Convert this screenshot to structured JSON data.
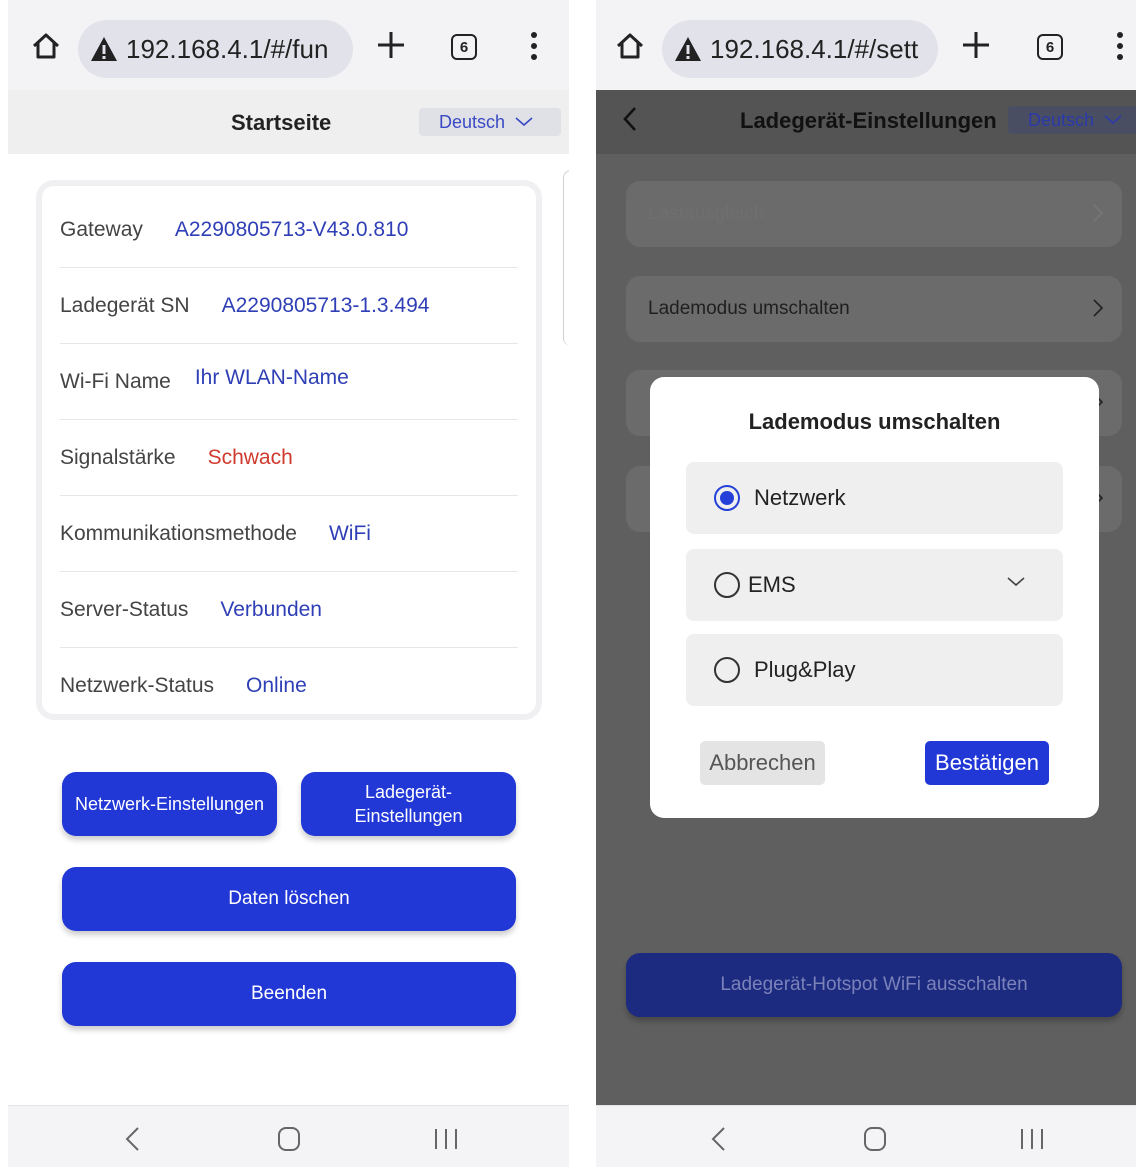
{
  "left": {
    "browser": {
      "url": "192.168.4.1/#/fun",
      "tab_count": "6"
    },
    "header": {
      "title": "Startseite",
      "language": "Deutsch"
    },
    "info": [
      {
        "label": "Gateway",
        "value": "A2290805713-V43.0.810",
        "color": "blue"
      },
      {
        "label": "Ladegerät SN",
        "value": "A2290805713-1.3.494",
        "color": "blue"
      },
      {
        "label": "Wi-Fi Name",
        "value": "Ihr WLAN-Name",
        "color": "blue"
      },
      {
        "label": "Signalstärke",
        "value": "Schwach",
        "color": "red"
      },
      {
        "label": "Kommunikationsmethode",
        "value": "WiFi",
        "color": "blue"
      },
      {
        "label": "Server-Status",
        "value": "Verbunden",
        "color": "blue"
      },
      {
        "label": "Netzwerk-Status",
        "value": "Online",
        "color": "blue"
      }
    ],
    "buttons": {
      "network_settings": "Netzwerk-Einstellungen",
      "charger_settings_line1": "Ladegerät-",
      "charger_settings_line2": "Einstellungen",
      "delete_data": "Daten löschen",
      "exit": "Beenden"
    }
  },
  "right": {
    "browser": {
      "url": "192.168.4.1/#/sett",
      "tab_count": "6"
    },
    "header": {
      "title": "Ladegerät-Einstellungen",
      "language": "Deutsch"
    },
    "settings_items": [
      "Lastausgleich",
      "Lademodus umschalten"
    ],
    "hotspot_button": "Ladegerät-Hotspot WiFi ausschalten",
    "modal": {
      "title": "Lademodus umschalten",
      "options": [
        {
          "label": "Netzwerk",
          "selected": true
        },
        {
          "label": "EMS",
          "selected": false
        },
        {
          "label": "Plug&Play",
          "selected": false
        }
      ],
      "cancel": "Abbrechen",
      "confirm": "Bestätigen"
    }
  },
  "colors": {
    "accent": "#2137d6",
    "value_blue": "#2f3fb5",
    "value_red": "#d03a2e"
  }
}
